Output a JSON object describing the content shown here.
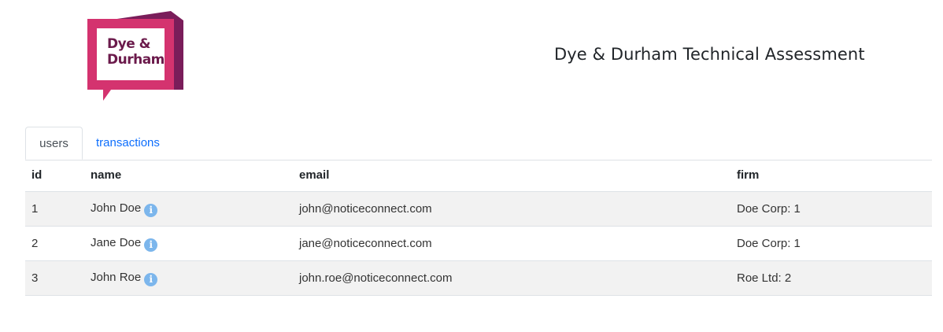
{
  "header": {
    "logo_text_line1": "Dye &",
    "logo_text_line2": "Durham",
    "title": "Dye & Durham Technical Assessment"
  },
  "tabs": [
    {
      "label": "users",
      "active": true
    },
    {
      "label": "transactions",
      "active": false
    }
  ],
  "table": {
    "columns": [
      "id",
      "name",
      "email",
      "firm"
    ],
    "rows": [
      {
        "id": "1",
        "name": "John Doe",
        "email": "john@noticeconnect.com",
        "firm": "Doe Corp: 1"
      },
      {
        "id": "2",
        "name": "Jane Doe",
        "email": "jane@noticeconnect.com",
        "firm": "Doe Corp: 1"
      },
      {
        "id": "3",
        "name": "John Roe",
        "email": "john.roe@noticeconnect.com",
        "firm": "Roe Ltd: 2"
      }
    ],
    "info_icon": "info-icon"
  },
  "colors": {
    "brand_pink": "#d4336f",
    "brand_purple": "#7a1d5a",
    "link": "#0d6efd",
    "info_icon": "#7cb6ec",
    "stripe": "#f2f2f2"
  }
}
